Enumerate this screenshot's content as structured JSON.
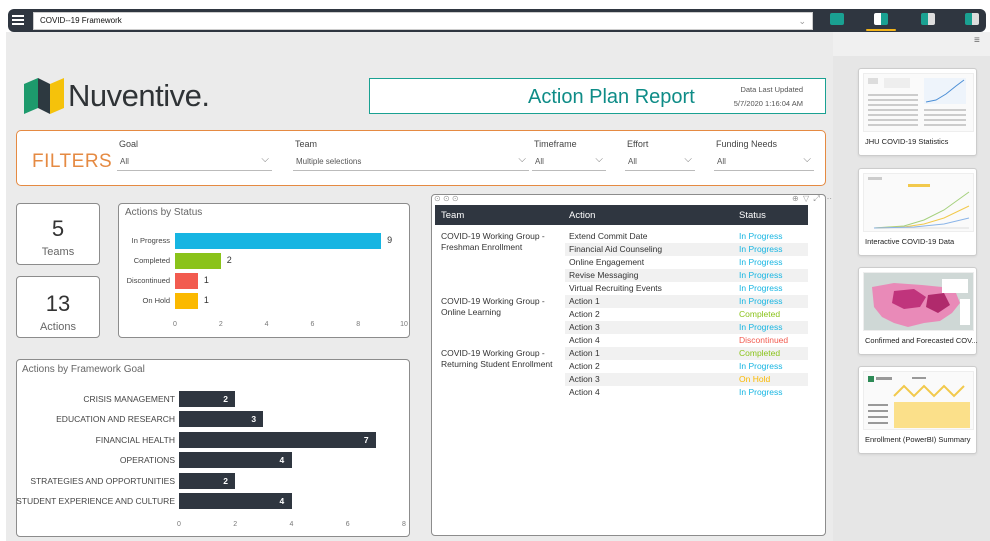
{
  "app": {
    "title": "COVID--19 Framework"
  },
  "colors": {
    "accent_orange": "#e58a42",
    "teal": "#0e8c87",
    "dark": "#2f3640",
    "in_progress": "#16b5e2",
    "completed": "#8ac31a",
    "discontinued": "#f25b4f",
    "on_hold": "#fbb900"
  },
  "header": {
    "brand": "Nuventive",
    "brand_dot": ".",
    "report_title": "Action Plan Report",
    "updated_label": "Data Last Updated",
    "updated_value": "5/7/2020 1:16:04 AM"
  },
  "filters": {
    "title": "FILTERS",
    "goal": {
      "label": "Goal",
      "value": "All"
    },
    "team": {
      "label": "Team",
      "value": "Multiple selections"
    },
    "timeframe": {
      "label": "Timeframe",
      "value": "All"
    },
    "effort": {
      "label": "Effort",
      "value": "All"
    },
    "funding": {
      "label": "Funding Needs",
      "value": "All"
    }
  },
  "kpis": {
    "teams": {
      "value": "5",
      "label": "Teams"
    },
    "actions": {
      "value": "13",
      "label": "Actions"
    }
  },
  "status_chart": {
    "title": "Actions by Status",
    "ticks": [
      "0",
      "2",
      "4",
      "6",
      "8",
      "10"
    ]
  },
  "framework_chart": {
    "title": "Actions by Framework Goal",
    "ticks": [
      "0",
      "2",
      "4",
      "6",
      "8"
    ]
  },
  "chart_data": [
    {
      "type": "bar",
      "orientation": "horizontal",
      "title": "Actions by Status",
      "categories": [
        "In Progress",
        "Completed",
        "Discontinued",
        "On Hold"
      ],
      "values": [
        9,
        2,
        1,
        1
      ],
      "colors": [
        "#16b5e2",
        "#8ac31a",
        "#f25b4f",
        "#fbb900"
      ],
      "xlim": [
        0,
        10
      ]
    },
    {
      "type": "bar",
      "orientation": "horizontal",
      "title": "Actions by Framework Goal",
      "categories": [
        "CRISIS MANAGEMENT",
        "EDUCATION AND RESEARCH",
        "FINANCIAL HEALTH",
        "OPERATIONS",
        "STRATEGIES AND OPPORTUNITIES",
        "STUDENT EXPERIENCE AND CULTURE"
      ],
      "values": [
        2,
        3,
        7,
        4,
        2,
        4
      ],
      "xlim": [
        0,
        8
      ]
    }
  ],
  "table": {
    "headers": {
      "team": "Team",
      "action": "Action",
      "status": "Status"
    },
    "teams": [
      {
        "line1": "COVID-19 Working Group -",
        "line2": "Freshman Enrollment"
      },
      {
        "line1": "COVID-19 Working Group -",
        "line2": "Online Learning"
      },
      {
        "line1": "COVID-19 Working Group -",
        "line2": "Returning Student Enrollment"
      }
    ],
    "rows": [
      {
        "action": "Extend Commit Date",
        "status": "In Progress"
      },
      {
        "action": "Financial Aid Counseling",
        "status": "In Progress"
      },
      {
        "action": "Online Engagement",
        "status": "In Progress"
      },
      {
        "action": "Revise Messaging",
        "status": "In Progress"
      },
      {
        "action": "Virtual Recruiting Events",
        "status": "In Progress"
      },
      {
        "action": "Action 1",
        "status": "In Progress"
      },
      {
        "action": "Action 2",
        "status": "Completed"
      },
      {
        "action": "Action 3",
        "status": "In Progress"
      },
      {
        "action": "Action 4",
        "status": "Discontinued"
      },
      {
        "action": "Action 1",
        "status": "Completed"
      },
      {
        "action": "Action 2",
        "status": "In Progress"
      },
      {
        "action": "Action 3",
        "status": "On Hold"
      },
      {
        "action": "Action 4",
        "status": "In Progress"
      }
    ]
  },
  "pages": [
    {
      "label": "JHU COVID-19 Statistics"
    },
    {
      "label": "Interactive COVID-19 Data"
    },
    {
      "label": "Confirmed and Forecasted COV..."
    },
    {
      "label": "Enrollment (PowerBI) Summary"
    }
  ]
}
